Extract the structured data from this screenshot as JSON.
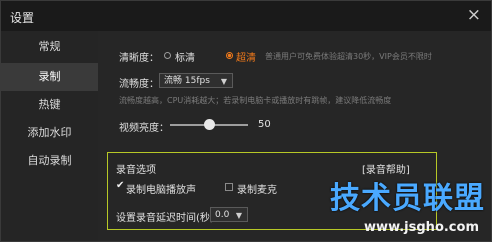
{
  "window": {
    "title": "设置",
    "close_symbol": "×"
  },
  "sidebar": {
    "items": [
      {
        "label": "常规",
        "active": false
      },
      {
        "label": "录制",
        "active": true
      },
      {
        "label": "热键",
        "active": false
      },
      {
        "label": "添加水印",
        "active": false
      },
      {
        "label": "自动录制",
        "active": false
      }
    ]
  },
  "settings": {
    "clarity": {
      "label": "清晰度：",
      "options": [
        "标清",
        "超清"
      ],
      "selected": "超清",
      "hint": "普通用户可免费体验超清30秒，VIP会员不限时"
    },
    "smoothness": {
      "label": "流畅度：",
      "value": "流畅 15fps",
      "hint": "流畅度越高，CPU消耗越大；若录制电脑卡或播放时有跳帧，建议降低流畅度"
    },
    "brightness": {
      "label": "视频亮度：",
      "value": "50",
      "level": 50,
      "max": 100
    }
  },
  "audio": {
    "title": "录音选项",
    "help_link": "[录音帮助]",
    "options": [
      {
        "label": "录制电脑播放声",
        "checked": true
      },
      {
        "label": "录制麦克",
        "checked": false
      }
    ],
    "delay_label": "设置录音延迟时间(秒)：",
    "delay_value": "0.0"
  },
  "watermark": {
    "line1": "技术员联盟",
    "line2": "www.jsgho.com"
  },
  "colors": {
    "accent": "#f27a1a",
    "box_border": "#b7c826",
    "watermark": "#4aa9ff"
  }
}
